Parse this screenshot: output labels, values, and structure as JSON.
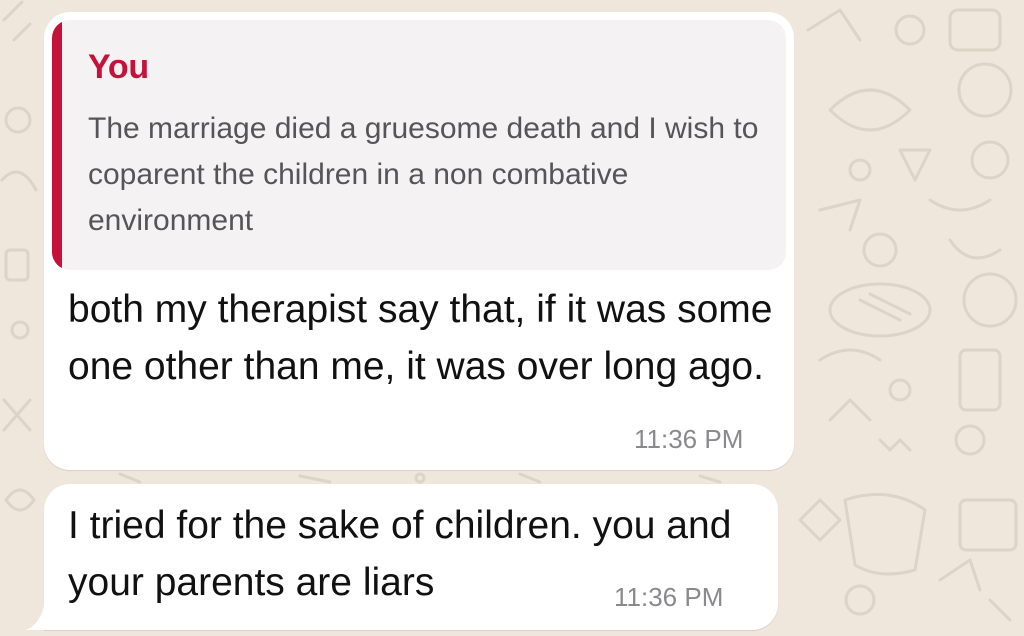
{
  "colors": {
    "wallpaper": "#efe7dc",
    "bubble": "#ffffff",
    "quote_background": "#f4f2f3",
    "quote_accent": "#c4123a",
    "message_text": "#111111",
    "timestamp": "#8a8a8e"
  },
  "messages": [
    {
      "reply_to": {
        "author": "You",
        "text": "The marriage died a gruesome death and I wish to coparent the children in a non combative environment"
      },
      "text": "both my therapist say that, if it was some one other than me, it was over long ago.",
      "time": "11:36 PM"
    },
    {
      "text": "I tried for the sake of children. you and your parents are liars",
      "time": "11:36 PM"
    }
  ]
}
